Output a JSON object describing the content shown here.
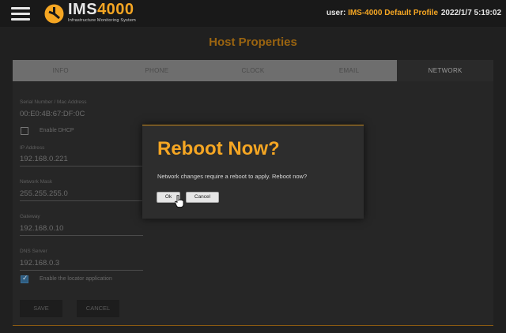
{
  "topbar": {
    "logo_main": "IMS",
    "logo_num": "4000",
    "logo_sub": "Infrastructure Monitoring System",
    "user_label": "user: ",
    "user_value": "IMS-4000 Default Profile",
    "datetime": "2022/1/7 5:19:02"
  },
  "page": {
    "title": "Host Properties"
  },
  "tabs": [
    {
      "label": "INFO",
      "active": false
    },
    {
      "label": "PHONE",
      "active": false
    },
    {
      "label": "CLOCK",
      "active": false
    },
    {
      "label": "EMAIL",
      "active": false
    },
    {
      "label": "NETWORK",
      "active": true
    }
  ],
  "form": {
    "serial_label": "Serial Number / Mac Address",
    "serial_value": "00:E0:4B:67:DF:0C",
    "dhcp_label": "Enable DHCP",
    "dhcp_checked": false,
    "ip_label": "IP Address",
    "ip_value": "192.168.0.221",
    "mask_label": "Network Mask",
    "mask_value": "255.255.255.0",
    "gateway_label": "Gateway",
    "gateway_value": "192.168.0.10",
    "dns_label": "DNS Server",
    "dns_value": "192.168.0.3",
    "locator_label": "Enable the locator application",
    "locator_checked": true,
    "save_label": "SAVE",
    "cancel_label": "CANCEL"
  },
  "dialog": {
    "title": "Reboot Now?",
    "message": "Network changes require a reboot to apply. Reboot now?",
    "ok_label": "Ok",
    "cancel_label": "Cancel"
  },
  "colors": {
    "accent": "#f5a623",
    "background": "#202020",
    "topbar": "#191919"
  },
  "icons": [
    "hamburger-icon",
    "ims-logo-icon",
    "cursor-hand-icon"
  ]
}
